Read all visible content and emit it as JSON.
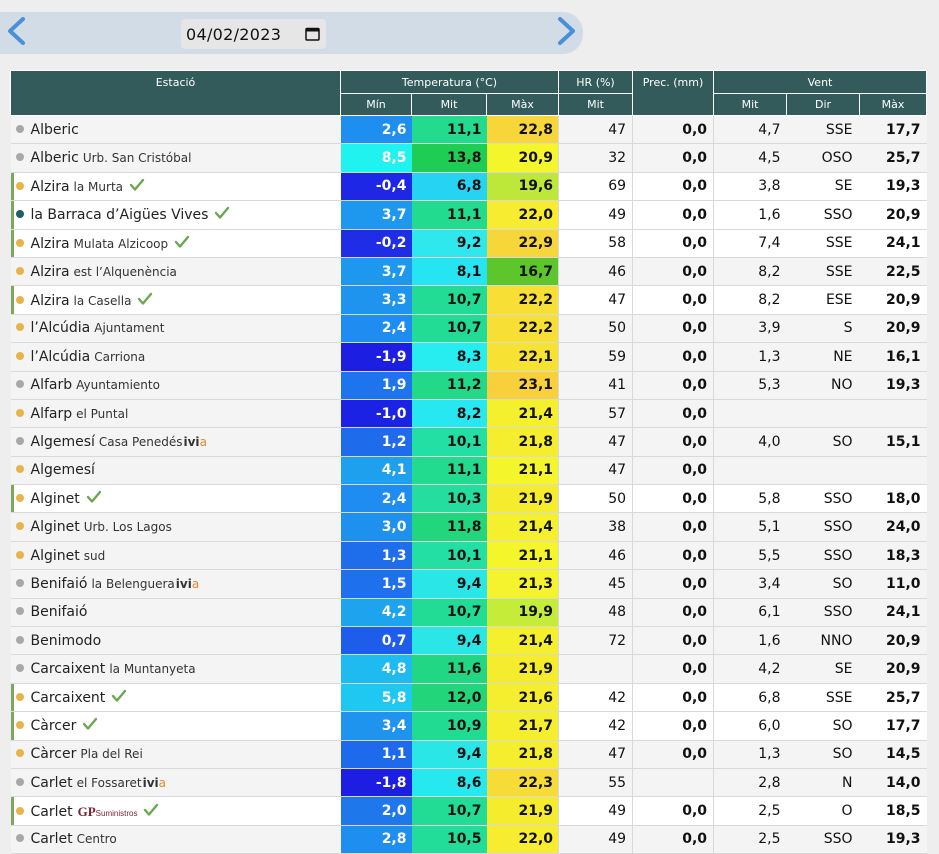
{
  "nav": {
    "date_value": "04/02/2023",
    "prev_icon": "chevron-left-icon",
    "next_icon": "chevron-right-icon",
    "calendar_icon": "calendar-icon",
    "accent": "#4a90d9"
  },
  "headers": {
    "station": "Estació",
    "temperature": "Temperatura (°C)",
    "hr": "HR (%)",
    "prec": "Prec. (mm)",
    "wind": "Vent",
    "min": "Mín",
    "mit": "Mit",
    "max": "Màx",
    "hr_mit": "Mit",
    "wind_mit": "Mit",
    "wind_dir": "Dir",
    "wind_max": "Màx"
  },
  "rows": [
    {
      "name": "Alberic",
      "sub": "",
      "dot": "grey",
      "hl": false,
      "badge": "",
      "min": "2,6",
      "mit": "11,1",
      "max": "22,8",
      "hr": "47",
      "prec": "0,0",
      "wmit": "4,7",
      "dir": "SSE",
      "wmax": "17,7",
      "cmin": "#1e8ff0",
      "cmit": "#22db8e",
      "cmax": "#f7d63a"
    },
    {
      "name": "Alberic",
      "sub": "Urb. San Cristóbal",
      "dot": "grey",
      "hl": false,
      "badge": "",
      "min": "8,5",
      "mit": "13,8",
      "max": "20,9",
      "hr": "32",
      "prec": "0,0",
      "wmit": "4,5",
      "dir": "OSO",
      "wmax": "25,7",
      "cmin": "#20f2f0",
      "cmit": "#1fcd55",
      "cmax": "#f5f52c"
    },
    {
      "name": "Alzira",
      "sub": "la Murta",
      "dot": "yellow",
      "hl": true,
      "badge": "check",
      "min": "-0,4",
      "mit": "6,8",
      "max": "19,6",
      "hr": "69",
      "prec": "0,0",
      "wmit": "3,8",
      "dir": "SE",
      "wmax": "19,3",
      "cmin": "#1f27e6",
      "cmit": "#27d3f2",
      "cmax": "#bde83a"
    },
    {
      "name": "la Barraca d’Aigües Vives",
      "sub": "",
      "dot": "teal",
      "hl": true,
      "badge": "check",
      "min": "3,7",
      "mit": "11,1",
      "max": "22,0",
      "hr": "49",
      "prec": "0,0",
      "wmit": "1,6",
      "dir": "SSO",
      "wmax": "20,9",
      "cmin": "#1e98ee",
      "cmit": "#22db8e",
      "cmax": "#f7ec2f"
    },
    {
      "name": "Alzira",
      "sub": "Mulata Alzicoop",
      "dot": "yellow",
      "hl": true,
      "badge": "check",
      "min": "-0,2",
      "mit": "9,2",
      "max": "22,9",
      "hr": "58",
      "prec": "0,0",
      "wmit": "7,4",
      "dir": "SSE",
      "wmax": "24,1",
      "cmin": "#1f2ee6",
      "cmit": "#2ee8ee",
      "cmax": "#f7d63a"
    },
    {
      "name": "Alzira",
      "sub": "est l’Alquenència",
      "dot": "yellow",
      "hl": false,
      "badge": "",
      "min": "3,7",
      "mit": "8,1",
      "max": "16,7",
      "hr": "46",
      "prec": "0,0",
      "wmit": "8,2",
      "dir": "SSE",
      "wmax": "22,5",
      "cmin": "#1e98ee",
      "cmit": "#27e4f2",
      "cmax": "#5cc62a"
    },
    {
      "name": "Alzira",
      "sub": "la Casella",
      "dot": "yellow",
      "hl": true,
      "badge": "check",
      "min": "3,3",
      "mit": "10,7",
      "max": "22,2",
      "hr": "47",
      "prec": "0,0",
      "wmit": "8,2",
      "dir": "ESE",
      "wmax": "20,9",
      "cmin": "#1e94ee",
      "cmit": "#22dc96",
      "cmax": "#f7df36"
    },
    {
      "name": "l’Alcúdia",
      "sub": "Ajuntament",
      "dot": "yellow",
      "hl": false,
      "badge": "",
      "min": "2,4",
      "mit": "10,7",
      "max": "22,2",
      "hr": "50",
      "prec": "0,0",
      "wmit": "3,9",
      "dir": "S",
      "wmax": "20,9",
      "cmin": "#1e8cf0",
      "cmit": "#22dc96",
      "cmax": "#f7df36"
    },
    {
      "name": "l’Alcúdia",
      "sub": "Carriona",
      "dot": "yellow",
      "hl": false,
      "badge": "",
      "min": "-1,9",
      "mit": "8,3",
      "max": "22,1",
      "hr": "59",
      "prec": "0,0",
      "wmit": "1,3",
      "dir": "NE",
      "wmax": "16,1",
      "cmin": "#1c1ee2",
      "cmit": "#27ecf0",
      "cmax": "#f7e233"
    },
    {
      "name": "Alfarb",
      "sub": "Ayuntamiento",
      "dot": "grey",
      "hl": false,
      "badge": "",
      "min": "1,9",
      "mit": "11,2",
      "max": "23,1",
      "hr": "41",
      "prec": "0,0",
      "wmit": "5,3",
      "dir": "NO",
      "wmax": "19,3",
      "cmin": "#1e74ec",
      "cmit": "#22d98a",
      "cmax": "#f7d03c"
    },
    {
      "name": "Alfarp",
      "sub": "el Puntal",
      "dot": "yellow",
      "hl": false,
      "badge": "",
      "min": "-1,0",
      "mit": "8,2",
      "max": "21,4",
      "hr": "57",
      "prec": "0,0",
      "wmit": "",
      "dir": "",
      "wmax": "",
      "cmin": "#1c22e4",
      "cmit": "#27e8f0",
      "cmax": "#f5f02e"
    },
    {
      "name": "Algemesí",
      "sub": "Casa Penedés",
      "dot": "grey",
      "hl": false,
      "badge": "ivia",
      "min": "1,2",
      "mit": "10,1",
      "max": "21,8",
      "hr": "47",
      "prec": "0,0",
      "wmit": "4,0",
      "dir": "SO",
      "wmax": "15,1",
      "cmin": "#1e6cec",
      "cmit": "#24dfa4",
      "cmax": "#f5ee2e"
    },
    {
      "name": "Algemesí",
      "sub": "",
      "dot": "yellow",
      "hl": false,
      "badge": "",
      "min": "4,1",
      "mit": "11,1",
      "max": "21,1",
      "hr": "47",
      "prec": "0,0",
      "wmit": "",
      "dir": "",
      "wmax": "",
      "cmin": "#1ea0ee",
      "cmit": "#22db8e",
      "cmax": "#f5f52c"
    },
    {
      "name": "Alginet",
      "sub": "",
      "dot": "yellow",
      "hl": true,
      "badge": "check",
      "min": "2,4",
      "mit": "10,3",
      "max": "21,9",
      "hr": "50",
      "prec": "0,0",
      "wmit": "5,8",
      "dir": "SSO",
      "wmax": "18,0",
      "cmin": "#1e8cf0",
      "cmit": "#24dd9e",
      "cmax": "#f5ec2e"
    },
    {
      "name": "Alginet",
      "sub": "Urb. Los Lagos",
      "dot": "yellow",
      "hl": false,
      "badge": "",
      "min": "3,0",
      "mit": "11,8",
      "max": "21,4",
      "hr": "38",
      "prec": "0,0",
      "wmit": "5,1",
      "dir": "SSO",
      "wmax": "24,0",
      "cmin": "#1e90ee",
      "cmit": "#22d67e",
      "cmax": "#f5f02e"
    },
    {
      "name": "Alginet",
      "sub": "sud",
      "dot": "yellow",
      "hl": false,
      "badge": "",
      "min": "1,3",
      "mit": "10,1",
      "max": "21,1",
      "hr": "46",
      "prec": "0,0",
      "wmit": "5,5",
      "dir": "SSO",
      "wmax": "18,3",
      "cmin": "#1e6eec",
      "cmit": "#24dfa4",
      "cmax": "#f5f52c"
    },
    {
      "name": "Benifaió",
      "sub": "la Belenguera",
      "dot": "grey",
      "hl": false,
      "badge": "ivia",
      "min": "1,5",
      "mit": "9,4",
      "max": "21,3",
      "hr": "45",
      "prec": "0,0",
      "wmit": "3,4",
      "dir": "SO",
      "wmax": "11,0",
      "cmin": "#1e70ec",
      "cmit": "#2ae6e6",
      "cmax": "#f5f22e"
    },
    {
      "name": "Benifaió",
      "sub": "",
      "dot": "grey",
      "hl": false,
      "badge": "",
      "min": "4,2",
      "mit": "10,7",
      "max": "19,9",
      "hr": "48",
      "prec": "0,0",
      "wmit": "6,1",
      "dir": "SSO",
      "wmax": "24,1",
      "cmin": "#1ea4ee",
      "cmit": "#22dc96",
      "cmax": "#c6ec3a"
    },
    {
      "name": "Benimodo",
      "sub": "",
      "dot": "grey",
      "hl": false,
      "badge": "",
      "min": "0,7",
      "mit": "9,4",
      "max": "21,4",
      "hr": "72",
      "prec": "0,0",
      "wmit": "1,6",
      "dir": "NNO",
      "wmax": "20,9",
      "cmin": "#1e5cea",
      "cmit": "#2ae6e6",
      "cmax": "#f5f02e"
    },
    {
      "name": "Carcaixent",
      "sub": "la Muntanyeta",
      "dot": "grey",
      "hl": false,
      "badge": "",
      "min": "4,8",
      "mit": "11,6",
      "max": "21,9",
      "hr": "",
      "prec": "0,0",
      "wmit": "4,2",
      "dir": "SE",
      "wmax": "20,9",
      "cmin": "#1ebaf0",
      "cmit": "#22d784",
      "cmax": "#f5ec2e"
    },
    {
      "name": "Carcaixent",
      "sub": "",
      "dot": "yellow",
      "hl": true,
      "badge": "check",
      "min": "5,8",
      "mit": "12,0",
      "max": "21,6",
      "hr": "42",
      "prec": "0,0",
      "wmit": "6,8",
      "dir": "SSE",
      "wmax": "25,7",
      "cmin": "#1ec8f0",
      "cmit": "#22d47a",
      "cmax": "#f5ee2e"
    },
    {
      "name": "Càrcer",
      "sub": "",
      "dot": "yellow",
      "hl": true,
      "badge": "check",
      "min": "3,4",
      "mit": "10,9",
      "max": "21,7",
      "hr": "42",
      "prec": "0,0",
      "wmit": "6,0",
      "dir": "SO",
      "wmax": "17,7",
      "cmin": "#1e94ee",
      "cmit": "#22db92",
      "cmax": "#f5ee2e"
    },
    {
      "name": "Càrcer",
      "sub": "Pla del Rei",
      "dot": "yellow",
      "hl": false,
      "badge": "",
      "min": "1,1",
      "mit": "9,4",
      "max": "21,8",
      "hr": "47",
      "prec": "0,0",
      "wmit": "1,3",
      "dir": "SO",
      "wmax": "14,5",
      "cmin": "#1e6aec",
      "cmit": "#2ae6e6",
      "cmax": "#f5ee2e"
    },
    {
      "name": "Carlet",
      "sub": "el Fossaret",
      "dot": "grey",
      "hl": false,
      "badge": "ivia",
      "min": "-1,8",
      "mit": "8,6",
      "max": "22,3",
      "hr": "55",
      "prec": "",
      "wmit": "2,8",
      "dir": "N",
      "wmax": "14,0",
      "cmin": "#1c1ee2",
      "cmit": "#27e8ee",
      "cmax": "#f7dc38"
    },
    {
      "name": "Carlet",
      "sub": "",
      "dot": "yellow",
      "hl": true,
      "badge": "gp",
      "min": "2,0",
      "mit": "10,7",
      "max": "21,9",
      "hr": "49",
      "prec": "0,0",
      "wmit": "2,5",
      "dir": "O",
      "wmax": "18,5",
      "cmin": "#1e78ec",
      "cmit": "#22dc96",
      "cmax": "#f5ec2e"
    },
    {
      "name": "Carlet",
      "sub": "Centro",
      "dot": "grey",
      "hl": false,
      "badge": "",
      "min": "2,8",
      "mit": "10,5",
      "max": "22,0",
      "hr": "49",
      "prec": "0,0",
      "wmit": "2,5",
      "dir": "SSO",
      "wmax": "19,3",
      "cmin": "#1e8ef0",
      "cmit": "#22dd9a",
      "cmax": "#f7ec2f"
    }
  ],
  "badges": {
    "ivia_text_a": "ivi",
    "ivia_text_b": "a",
    "gp_text": "GP",
    "gp_small": "Suministros"
  }
}
